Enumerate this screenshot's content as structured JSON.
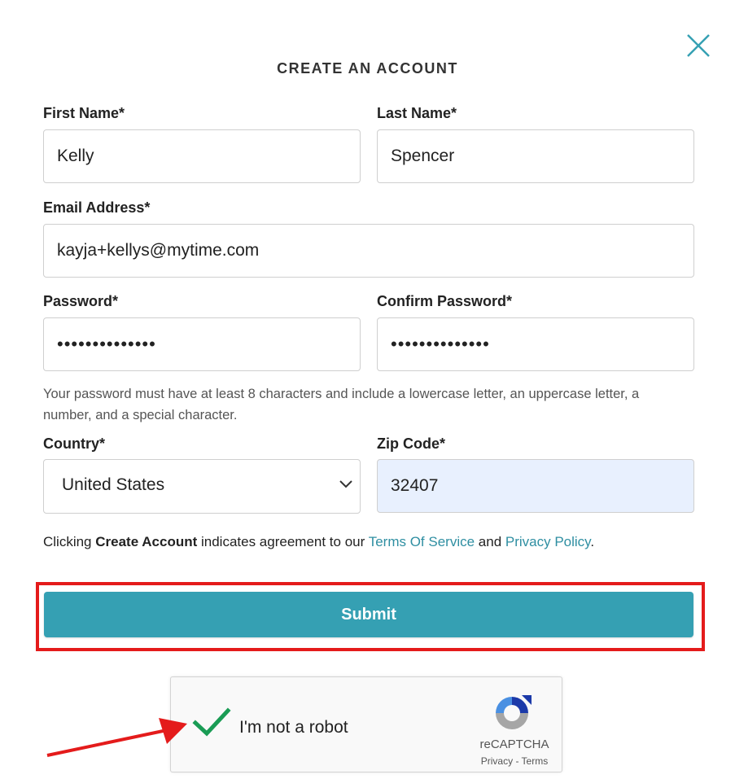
{
  "dialog": {
    "title": "CREATE AN ACCOUNT"
  },
  "form": {
    "first_name": {
      "label": "First Name*",
      "value": "Kelly"
    },
    "last_name": {
      "label": "Last Name*",
      "value": "Spencer"
    },
    "email": {
      "label": "Email Address*",
      "value": "kayja+kellys@mytime.com"
    },
    "password": {
      "label": "Password*",
      "value": "••••••••••••••"
    },
    "confirm_password": {
      "label": "Confirm Password*",
      "value": "••••••••••••••"
    },
    "password_hint": "Your password must have at least 8 characters and include a lowercase letter, an uppercase letter, a number, and a special character.",
    "country": {
      "label": "Country*",
      "value": "United States"
    },
    "zip": {
      "label": "Zip Code*",
      "value": "32407"
    }
  },
  "agreement": {
    "prefix": "Clicking ",
    "bold": "Create Account",
    "middle": " indicates agreement to our ",
    "terms_link": "Terms Of Service",
    "and": " and ",
    "privacy_link": "Privacy Policy",
    "suffix": "."
  },
  "submit_label": "Submit",
  "recaptcha": {
    "label": "I'm not a robot",
    "brand": "reCAPTCHA",
    "links": "Privacy - Terms",
    "checked": true
  },
  "icons": {
    "close": "close-icon",
    "chevron": "chevron-down-icon",
    "check": "checkmark-icon",
    "recaptcha_logo": "recaptcha-logo-icon",
    "annotation_arrow": "arrow-icon"
  },
  "colors": {
    "accent": "#35a0b3",
    "link": "#2f8fa2",
    "highlight_frame": "#e41b1b",
    "autofill_bg": "#e8f0fe",
    "check": "#1a9c55"
  }
}
